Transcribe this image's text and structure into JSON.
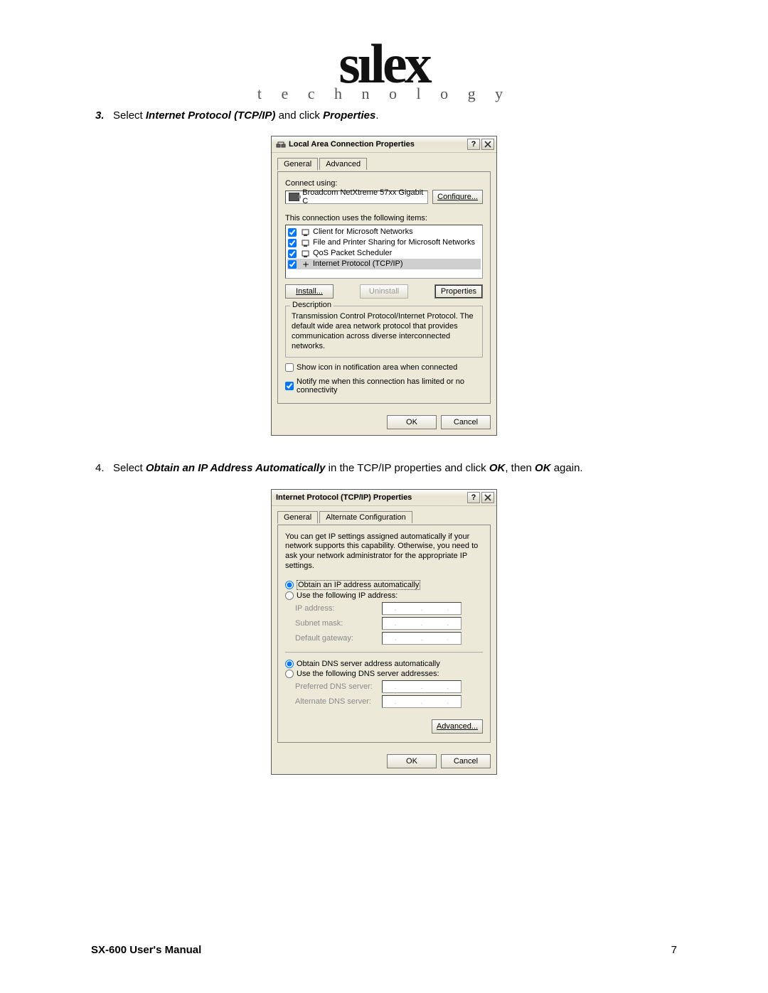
{
  "logo": {
    "main": "sılex",
    "sub": "t e c h n o l o g y"
  },
  "step3": {
    "num": "3.",
    "pre": "Select ",
    "bi1": "Internet Protocol (TCP/IP)",
    "mid": " and click ",
    "bi2": "Properties",
    "post": "."
  },
  "dlg1": {
    "title": "Local Area Connection Properties",
    "tabs": {
      "general": "General",
      "advanced": "Advanced"
    },
    "connect_using": "Connect using:",
    "adapter": "Broadcom NetXtreme 57xx Gigabit C",
    "configure": "Configure...",
    "items_label": "This connection uses the following items:",
    "items": [
      "Client for Microsoft Networks",
      "File and Printer Sharing for Microsoft Networks",
      "QoS Packet Scheduler",
      "Internet Protocol (TCP/IP)"
    ],
    "install": "Install...",
    "uninstall": "Uninstall",
    "properties": "Properties",
    "desc_label": "Description",
    "desc": "Transmission Control Protocol/Internet Protocol. The default wide area network protocol that provides communication across diverse interconnected networks.",
    "show_icon": "Show icon in notification area when connected",
    "notify": "Notify me when this connection has limited or no connectivity",
    "ok": "OK",
    "cancel": "Cancel"
  },
  "step4": {
    "num": "4.",
    "pre": "Select ",
    "bi1": "Obtain an IP Address Automatically",
    "mid1": " in the TCP/IP properties and click ",
    "bi2": "OK",
    "mid2": ", then ",
    "bi3": "OK",
    "post": " again."
  },
  "dlg2": {
    "title": "Internet Protocol (TCP/IP) Properties",
    "tabs": {
      "general": "General",
      "alt": "Alternate Configuration"
    },
    "intro": "You can get IP settings assigned automatically if your network supports this capability. Otherwise, you need to ask your network administrator for the appropriate IP settings.",
    "obtain_ip": "Obtain an IP address automatically",
    "use_ip": "Use the following IP address:",
    "ip_address": "IP address:",
    "subnet": "Subnet mask:",
    "gateway": "Default gateway:",
    "obtain_dns": "Obtain DNS server address automatically",
    "use_dns": "Use the following DNS server addresses:",
    "pref_dns": "Preferred DNS server:",
    "alt_dns": "Alternate DNS server:",
    "advanced": "Advanced...",
    "ok": "OK",
    "cancel": "Cancel"
  },
  "footer": {
    "manual": "SX-600 User's Manual",
    "page": "7"
  }
}
